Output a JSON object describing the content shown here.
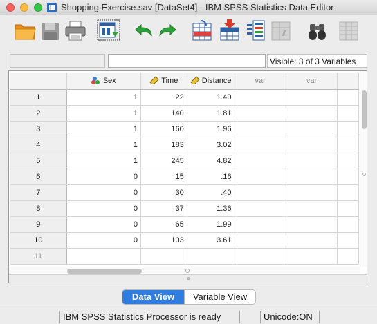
{
  "window": {
    "title": "Shopping Exercise.sav [DataSet4] - IBM SPSS Statistics Data Editor"
  },
  "toolbar": {
    "buttons": [
      {
        "name": "open-data-document",
        "icon": "folder-icon"
      },
      {
        "name": "save-document",
        "icon": "floppy-disk-icon"
      },
      {
        "name": "print",
        "icon": "printer-icon"
      },
      {
        "name": "recall-dialog",
        "icon": "dialog-recall-icon"
      },
      {
        "name": "undo",
        "icon": "undo-arrow-icon"
      },
      {
        "name": "redo",
        "icon": "redo-arrow-icon"
      },
      {
        "name": "go-to-case",
        "icon": "go-to-case-icon"
      },
      {
        "name": "go-to-variable",
        "icon": "go-to-variable-icon"
      },
      {
        "name": "variables",
        "icon": "variables-icon"
      },
      {
        "name": "run-descriptive-statistics",
        "icon": "disabled-stats-icon"
      },
      {
        "name": "find",
        "icon": "binoculars-icon"
      },
      {
        "name": "insert-cases",
        "icon": "disabled-grid-icon"
      }
    ]
  },
  "cell_info": {
    "cell_name": "",
    "cell_value": "",
    "visible_label": "Visible: 3 of 3 Variables"
  },
  "grid": {
    "columns": [
      {
        "label": "Sex",
        "icon": "nominal-measure-icon",
        "is_variable": true
      },
      {
        "label": "Time",
        "icon": "scale-measure-icon",
        "is_variable": true
      },
      {
        "label": "Distance",
        "icon": "scale-measure-icon",
        "is_variable": true
      },
      {
        "label": "var",
        "icon": "",
        "is_variable": false
      },
      {
        "label": "var",
        "icon": "",
        "is_variable": false
      }
    ],
    "rows": [
      {
        "num": "1",
        "cells": [
          "1",
          "22",
          "1.40",
          "",
          ""
        ]
      },
      {
        "num": "2",
        "cells": [
          "1",
          "140",
          "1.81",
          "",
          ""
        ]
      },
      {
        "num": "3",
        "cells": [
          "1",
          "160",
          "1.96",
          "",
          ""
        ]
      },
      {
        "num": "4",
        "cells": [
          "1",
          "183",
          "3.02",
          "",
          ""
        ]
      },
      {
        "num": "5",
        "cells": [
          "1",
          "245",
          "4.82",
          "",
          ""
        ]
      },
      {
        "num": "6",
        "cells": [
          "0",
          "15",
          ".16",
          "",
          ""
        ]
      },
      {
        "num": "7",
        "cells": [
          "0",
          "30",
          ".40",
          "",
          ""
        ]
      },
      {
        "num": "8",
        "cells": [
          "0",
          "37",
          "1.36",
          "",
          ""
        ]
      },
      {
        "num": "9",
        "cells": [
          "0",
          "65",
          "1.99",
          "",
          ""
        ]
      },
      {
        "num": "10",
        "cells": [
          "0",
          "103",
          "3.61",
          "",
          ""
        ]
      },
      {
        "num": "11",
        "cells": [
          "",
          "",
          "",
          "",
          ""
        ],
        "empty": true
      }
    ]
  },
  "tabs": {
    "data_view": "Data View",
    "variable_view": "Variable View",
    "active": "Data View"
  },
  "status": {
    "processor": "IBM SPSS Statistics Processor is ready",
    "unicode": "Unicode:ON"
  },
  "colors": {
    "active_tab": "#2f7de1",
    "close": "#fc605c",
    "minimize": "#fdbc40",
    "maximize": "#34c84a"
  }
}
